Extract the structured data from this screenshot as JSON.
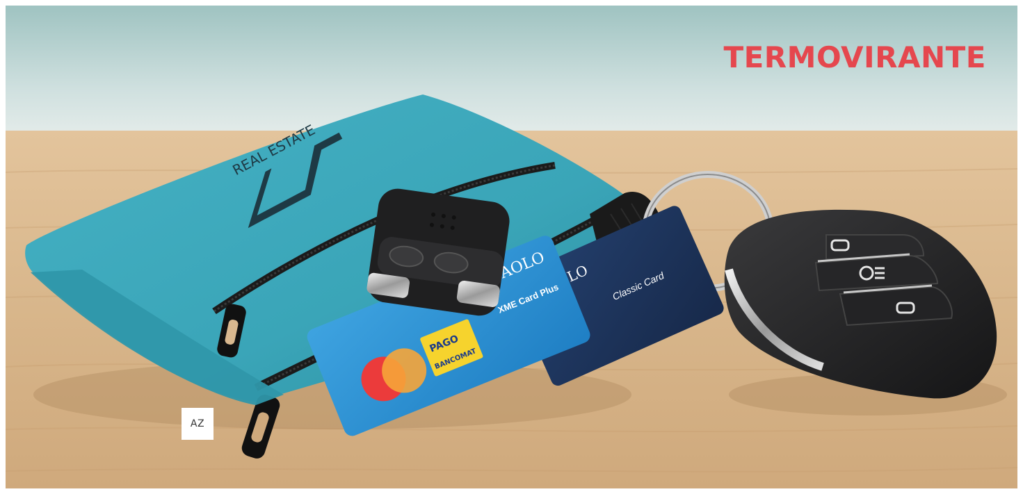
{
  "brand": {
    "name": "TERMOVIRANTE",
    "color": "#e5474e"
  },
  "overlay": {
    "tag_label": "AZ"
  },
  "photo": {
    "pouch_color": "#3aa5b8",
    "pouch_logo_text": "REAL ESTATE",
    "card_front": {
      "bank": "SANPAOLO",
      "product": "XME Card Plus",
      "badge_top": "PAGO",
      "badge_bottom": "BANCOMAT"
    },
    "card_back": {
      "bank": "PAOLO",
      "product": "Classic Card"
    }
  }
}
